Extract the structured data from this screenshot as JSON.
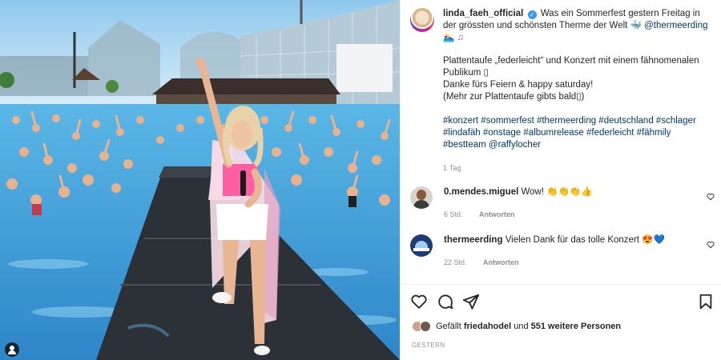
{
  "post": {
    "username": "linda_faeh_official",
    "caption_line": "Was ein Sommerfest gestern Freitag in der grössten und schönsten Therme der Welt",
    "mention_1": "@thermeerding",
    "paragraph_1": "Plattentaufe „federleicht“ und Konzert mit einem fähnomenalen Publikum ▯",
    "paragraph_2": "Danke fürs Feiern & happy saturday!",
    "paragraph_3": "(Mehr zur Plattentaufe gibts bald▯)",
    "hashtags": "#konzert #sommerfest #thermeerding #deutschland #schlager #lindafäh #onstage #albumrelease #federleicht #fähmily #bestteam @raffylocher",
    "age": "1 Tag"
  },
  "comments": [
    {
      "username": "0.mendes.miguel",
      "text": "Wow! 👏👏👏👍",
      "age": "6 Std.",
      "reply_label": "Antworten"
    },
    {
      "username": "thermeerding",
      "text": "Vielen Dank für das tolle Konzert 😍💙",
      "age": "22 Std.",
      "reply_label": "Antworten"
    }
  ],
  "likes": {
    "prefix": "Gefällt",
    "liker": "friedahodel",
    "connector": "und",
    "others": "551 weitere Personen"
  },
  "date_label": "GESTERN",
  "icons": [
    "verified-badge-icon",
    "heart-icon",
    "comment-icon",
    "share-icon",
    "bookmark-icon",
    "user-tag-icon"
  ],
  "colors": {
    "link": "#00376b",
    "verified": "#3897f0",
    "muted": "#8e8e8e",
    "pool": "#4fa9de",
    "stage": "#2c3138",
    "top": "#ff5fa2"
  }
}
